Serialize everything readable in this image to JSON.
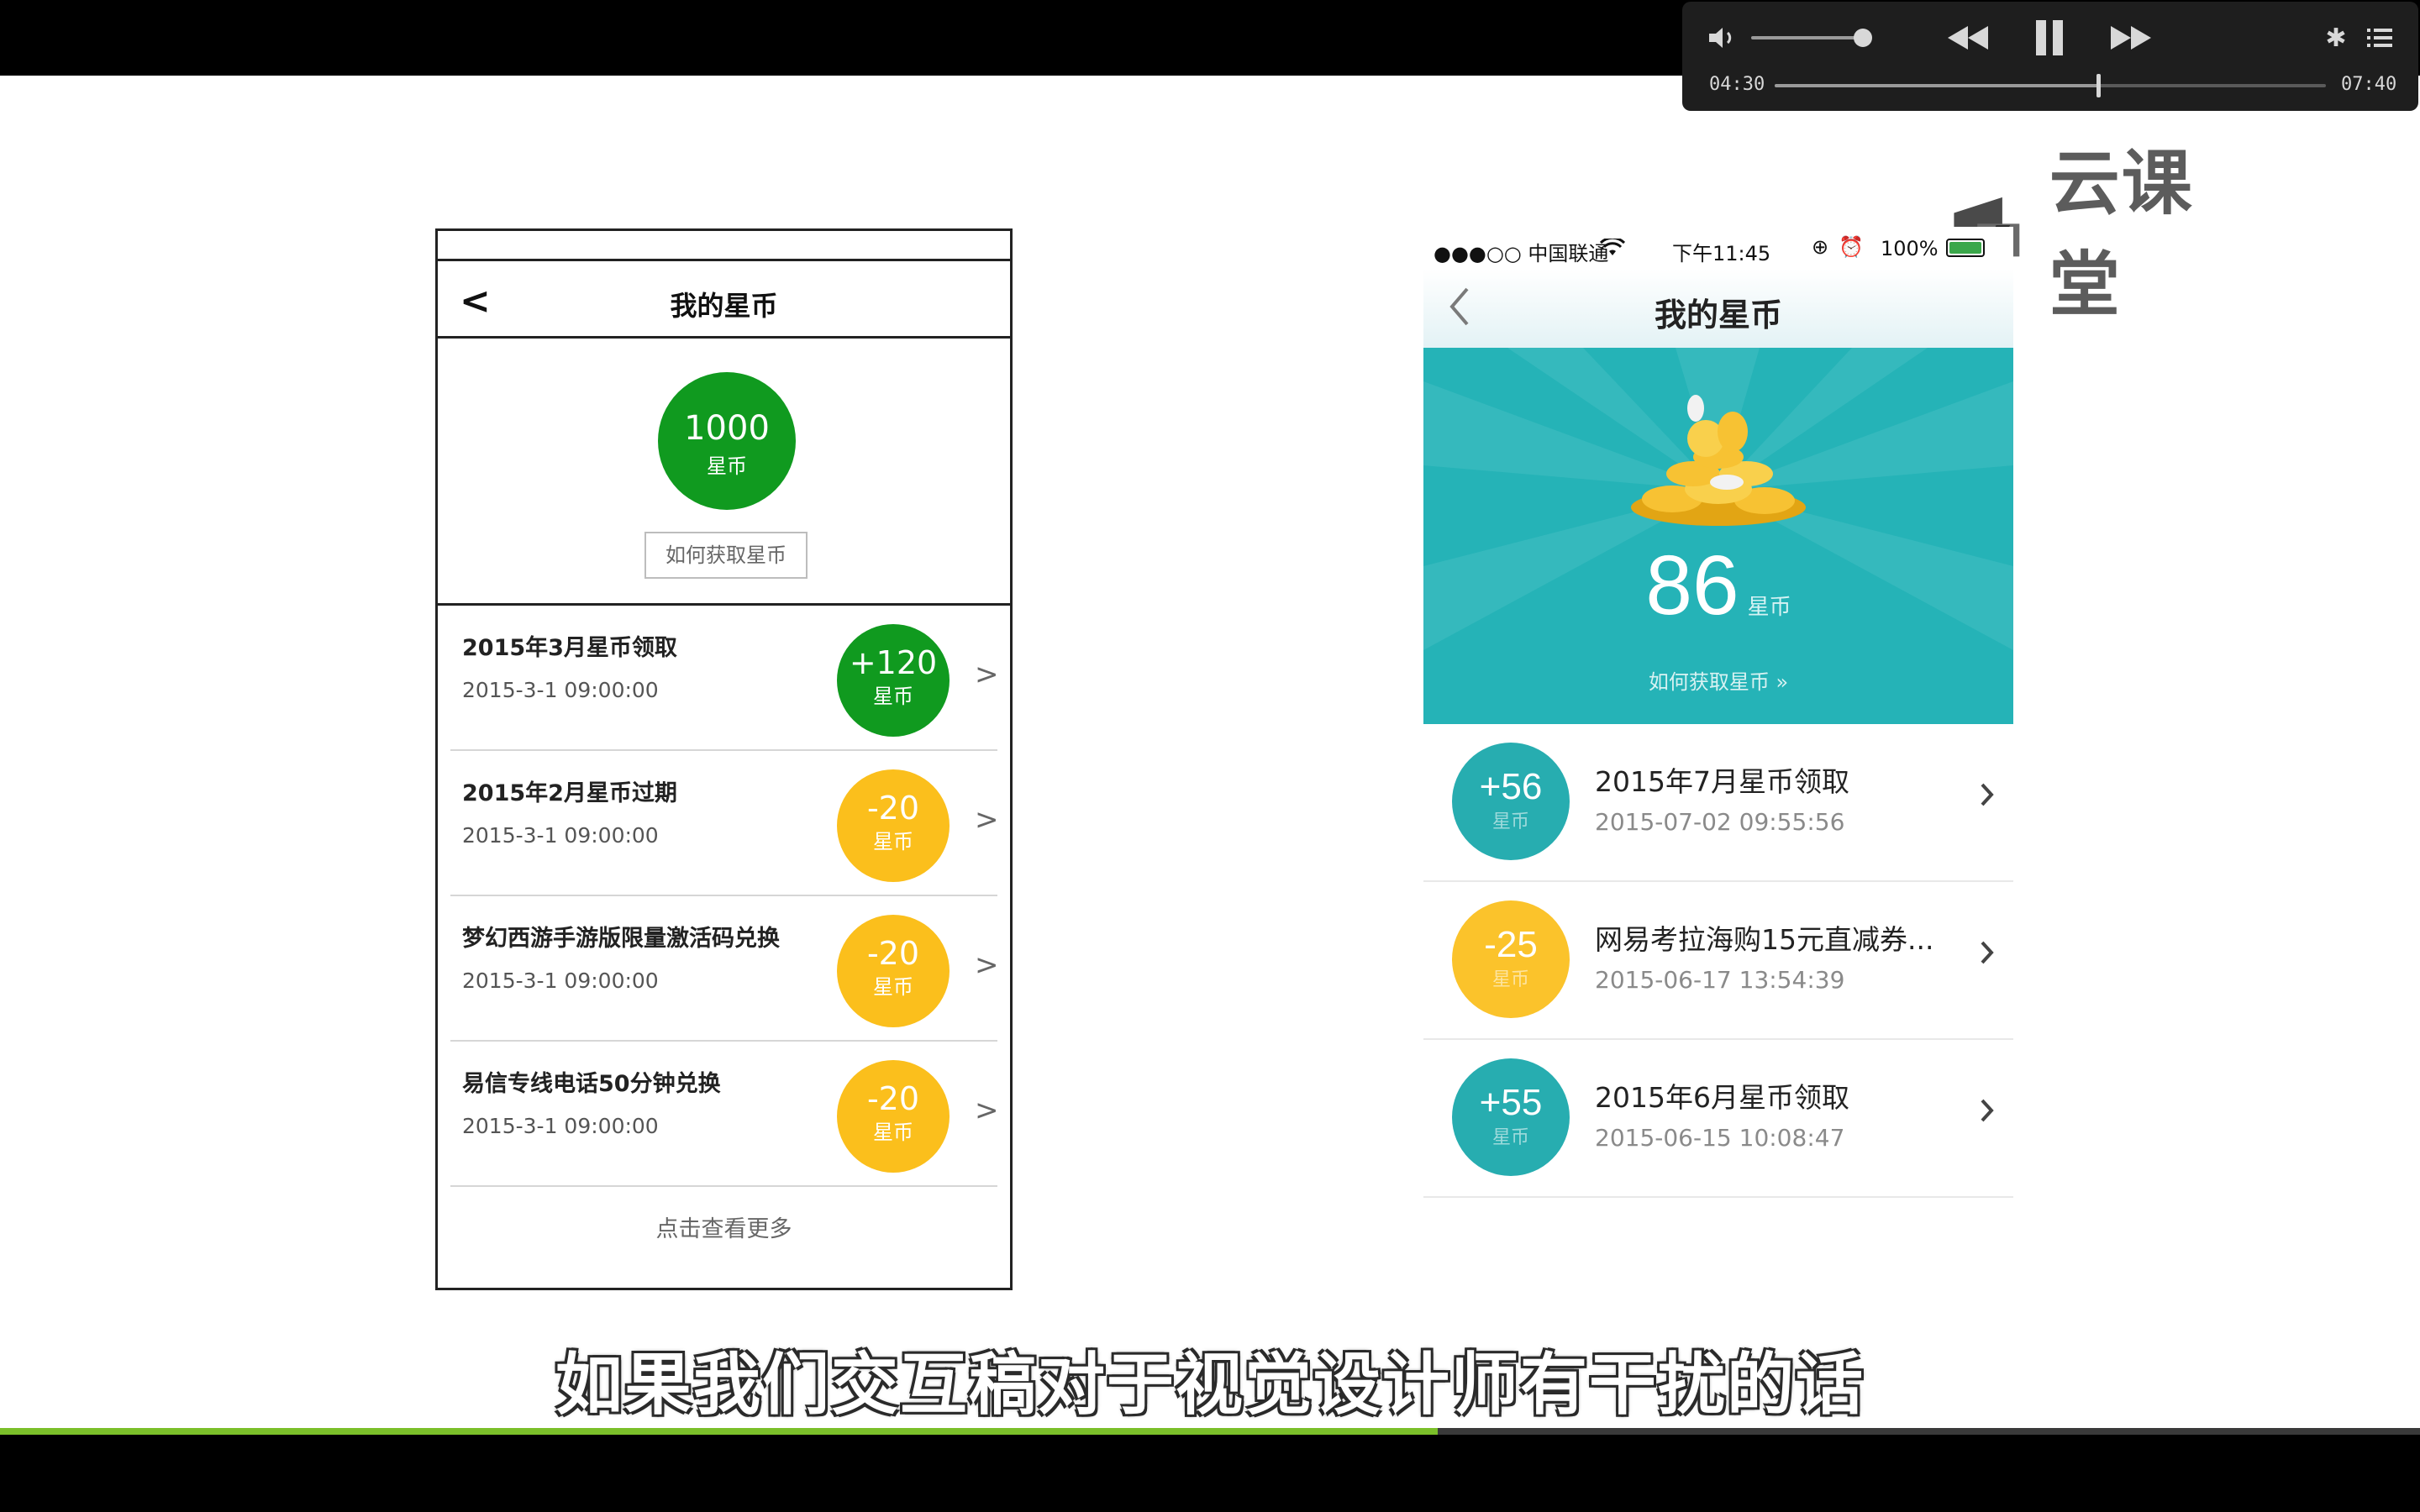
{
  "player": {
    "elapsed": "04:30",
    "total": "07:40",
    "progress": 0.587,
    "volume": 0.85,
    "icons": [
      "volume-icon",
      "rewind-icon",
      "pause-icon",
      "fast-forward-icon",
      "settings-icon",
      "playlist-icon"
    ]
  },
  "watermark": {
    "text": "云课堂"
  },
  "wireframe": {
    "title": "我的星币",
    "back": "<",
    "balance": {
      "amount": "1000",
      "unit": "星币"
    },
    "how_button": "如何获取星币",
    "rows": [
      {
        "title": "2015年3月星币领取",
        "date": "2015-3-1 09:00:00",
        "sign": "+",
        "amount": "120",
        "unit": "星币",
        "color": "#109a1f"
      },
      {
        "title": "2015年2月星币过期",
        "date": "2015-3-1 09:00:00",
        "sign": "-",
        "amount": "20",
        "unit": "星币",
        "color": "#fbbf1c"
      },
      {
        "title": "梦幻西游手游版限量激活码兑换",
        "date": "2015-3-1 09:00:00",
        "sign": "-",
        "amount": "20",
        "unit": "星币",
        "color": "#fbbf1c"
      },
      {
        "title": "易信专线电话50分钟兑换",
        "date": "2015-3-1 09:00:00",
        "sign": "-",
        "amount": "20",
        "unit": "星币",
        "color": "#fbbf1c"
      }
    ],
    "chevron": ">",
    "more": "点击查看更多"
  },
  "phone": {
    "status": {
      "carrier": "●●●○○ 中国联通",
      "time": "下午11:45",
      "battery": "100%"
    },
    "title": "我的星币",
    "balance": {
      "amount": "86",
      "unit": "星币"
    },
    "how_link": "如何获取星币 »",
    "rows": [
      {
        "amount": "+56",
        "unit": "星币",
        "title": "2015年7月星币领取",
        "date": "2015-07-02 09:55:56",
        "color": "#27adb0"
      },
      {
        "amount": "-25",
        "unit": "星币",
        "title": "网易考拉海购15元直减券...",
        "date": "2015-06-17 13:54:39",
        "color": "#fbc32b"
      },
      {
        "amount": "+55",
        "unit": "星币",
        "title": "2015年6月星币领取",
        "date": "2015-06-15 10:08:47",
        "color": "#27adb0"
      }
    ],
    "colors": {
      "banner": "#25b3b7",
      "coin_gold": "#f7c233"
    }
  },
  "caption": "如果我们交互稿对于视觉设计师有干扰的话",
  "video_progress": 0.594
}
